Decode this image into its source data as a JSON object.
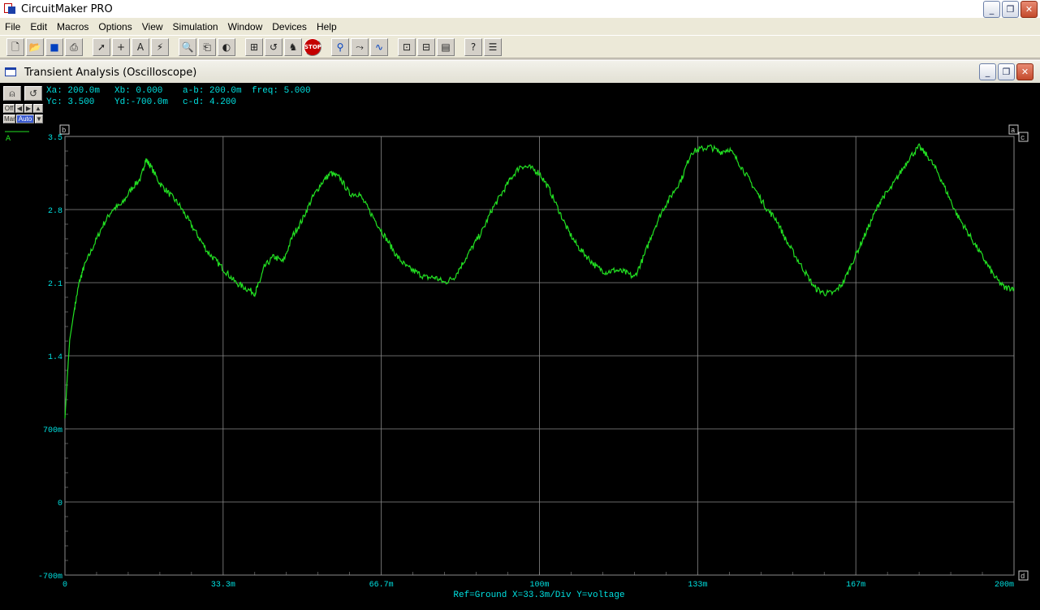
{
  "app": {
    "title": "CircuitMaker PRO"
  },
  "menu": [
    "File",
    "Edit",
    "Macros",
    "Options",
    "View",
    "Simulation",
    "Window",
    "Devices",
    "Help"
  ],
  "window_buttons": {
    "minimize": "_",
    "restore": "❐",
    "close": "✕"
  },
  "child_window": {
    "title": "Transient Analysis (Oscilloscope)"
  },
  "toolbar_icons": [
    "new-icon",
    "open-icon",
    "save-icon",
    "print-icon",
    "arrow-icon",
    "wire-icon",
    "text-icon",
    "probe-icon",
    "zoom-icon",
    "copy-icon",
    "flip-icon",
    "digital-icon",
    "reset-icon",
    "run-icon",
    "stop-icon",
    "probe-tool-icon",
    "trace-icon",
    "scope-icon",
    "zoom-fit-icon",
    "bus-icon",
    "part-icon",
    "help-icon",
    "settings-icon"
  ],
  "scope": {
    "readout": {
      "xa": "Xa: 200.0m",
      "xb": "Xb: 0.000",
      "ab": "a-b: 200.0m",
      "freq": "freq: 5.000",
      "yc": "Yc: 3.500",
      "yd": "Yd:-700.0m",
      "cd": "c-d: 4.200"
    },
    "controls": {
      "off": "Off",
      "man": "Man",
      "auto": "Auto"
    },
    "trace_label": "A",
    "footer": "Ref=Ground  X=33.3m/Div Y=voltage",
    "colors": {
      "background": "#000000",
      "trace": "#22e022",
      "grid": "#8a8a8a",
      "text": "#00e0e0"
    },
    "cursors": {
      "b": "b",
      "a": "a",
      "c": "c",
      "d": "d"
    }
  },
  "chart_data": {
    "type": "line",
    "title": "",
    "xlabel": "",
    "ylabel": "",
    "x_ticks": [
      "0",
      "33.3m",
      "66.7m",
      "100m",
      "133m",
      "167m",
      "200m"
    ],
    "y_ticks": [
      "3.5",
      "2.8",
      "2.1",
      "1.4",
      "700m",
      "0",
      "-700m"
    ],
    "xlim": [
      0,
      0.2
    ],
    "ylim": [
      -0.7,
      3.5
    ],
    "grid": true,
    "series": [
      {
        "color": "#22e022",
        "x": [
          0,
          0.0005,
          0.001,
          0.002,
          0.003,
          0.004,
          0.006,
          0.008,
          0.01,
          0.012,
          0.014,
          0.016,
          0.017,
          0.018,
          0.02,
          0.022,
          0.024,
          0.026,
          0.028,
          0.03,
          0.032,
          0.034,
          0.036,
          0.038,
          0.04,
          0.041,
          0.042,
          0.044,
          0.046,
          0.048,
          0.05,
          0.052,
          0.054,
          0.056,
          0.058,
          0.06,
          0.062,
          0.064,
          0.066,
          0.068,
          0.07,
          0.072,
          0.074,
          0.076,
          0.078,
          0.08,
          0.082,
          0.084,
          0.086,
          0.088,
          0.09,
          0.092,
          0.094,
          0.096,
          0.098,
          0.1,
          0.102,
          0.104,
          0.106,
          0.108,
          0.11,
          0.112,
          0.114,
          0.116,
          0.118,
          0.12,
          0.122,
          0.124,
          0.126,
          0.128,
          0.13,
          0.132,
          0.134,
          0.136,
          0.138,
          0.14,
          0.142,
          0.144,
          0.146,
          0.148,
          0.15,
          0.152,
          0.154,
          0.156,
          0.158,
          0.16,
          0.162,
          0.164,
          0.166,
          0.168,
          0.17,
          0.172,
          0.174,
          0.176,
          0.178,
          0.18,
          0.182,
          0.184,
          0.186,
          0.188,
          0.19,
          0.192,
          0.194,
          0.196,
          0.198,
          0.2
        ],
        "y": [
          0.8,
          1.2,
          1.55,
          1.85,
          2.1,
          2.25,
          2.45,
          2.65,
          2.8,
          2.85,
          3.0,
          3.1,
          3.28,
          3.22,
          3.05,
          2.95,
          2.85,
          2.7,
          2.55,
          2.4,
          2.3,
          2.2,
          2.1,
          2.05,
          2.0,
          2.1,
          2.25,
          2.35,
          2.3,
          2.55,
          2.7,
          2.9,
          3.05,
          3.15,
          3.1,
          2.95,
          2.95,
          2.8,
          2.65,
          2.5,
          2.35,
          2.25,
          2.2,
          2.15,
          2.15,
          2.1,
          2.15,
          2.3,
          2.45,
          2.6,
          2.8,
          2.95,
          3.1,
          3.22,
          3.2,
          3.15,
          3.0,
          2.8,
          2.6,
          2.45,
          2.35,
          2.25,
          2.2,
          2.22,
          2.2,
          2.15,
          2.35,
          2.6,
          2.8,
          2.95,
          3.1,
          3.35,
          3.38,
          3.4,
          3.35,
          3.38,
          3.25,
          3.1,
          2.95,
          2.8,
          2.7,
          2.5,
          2.35,
          2.2,
          2.05,
          2.0,
          2.0,
          2.1,
          2.3,
          2.5,
          2.7,
          2.9,
          3.0,
          3.15,
          3.3,
          3.4,
          3.3,
          3.15,
          2.95,
          2.75,
          2.6,
          2.45,
          2.3,
          2.15,
          2.05,
          2.05
        ]
      }
    ]
  }
}
